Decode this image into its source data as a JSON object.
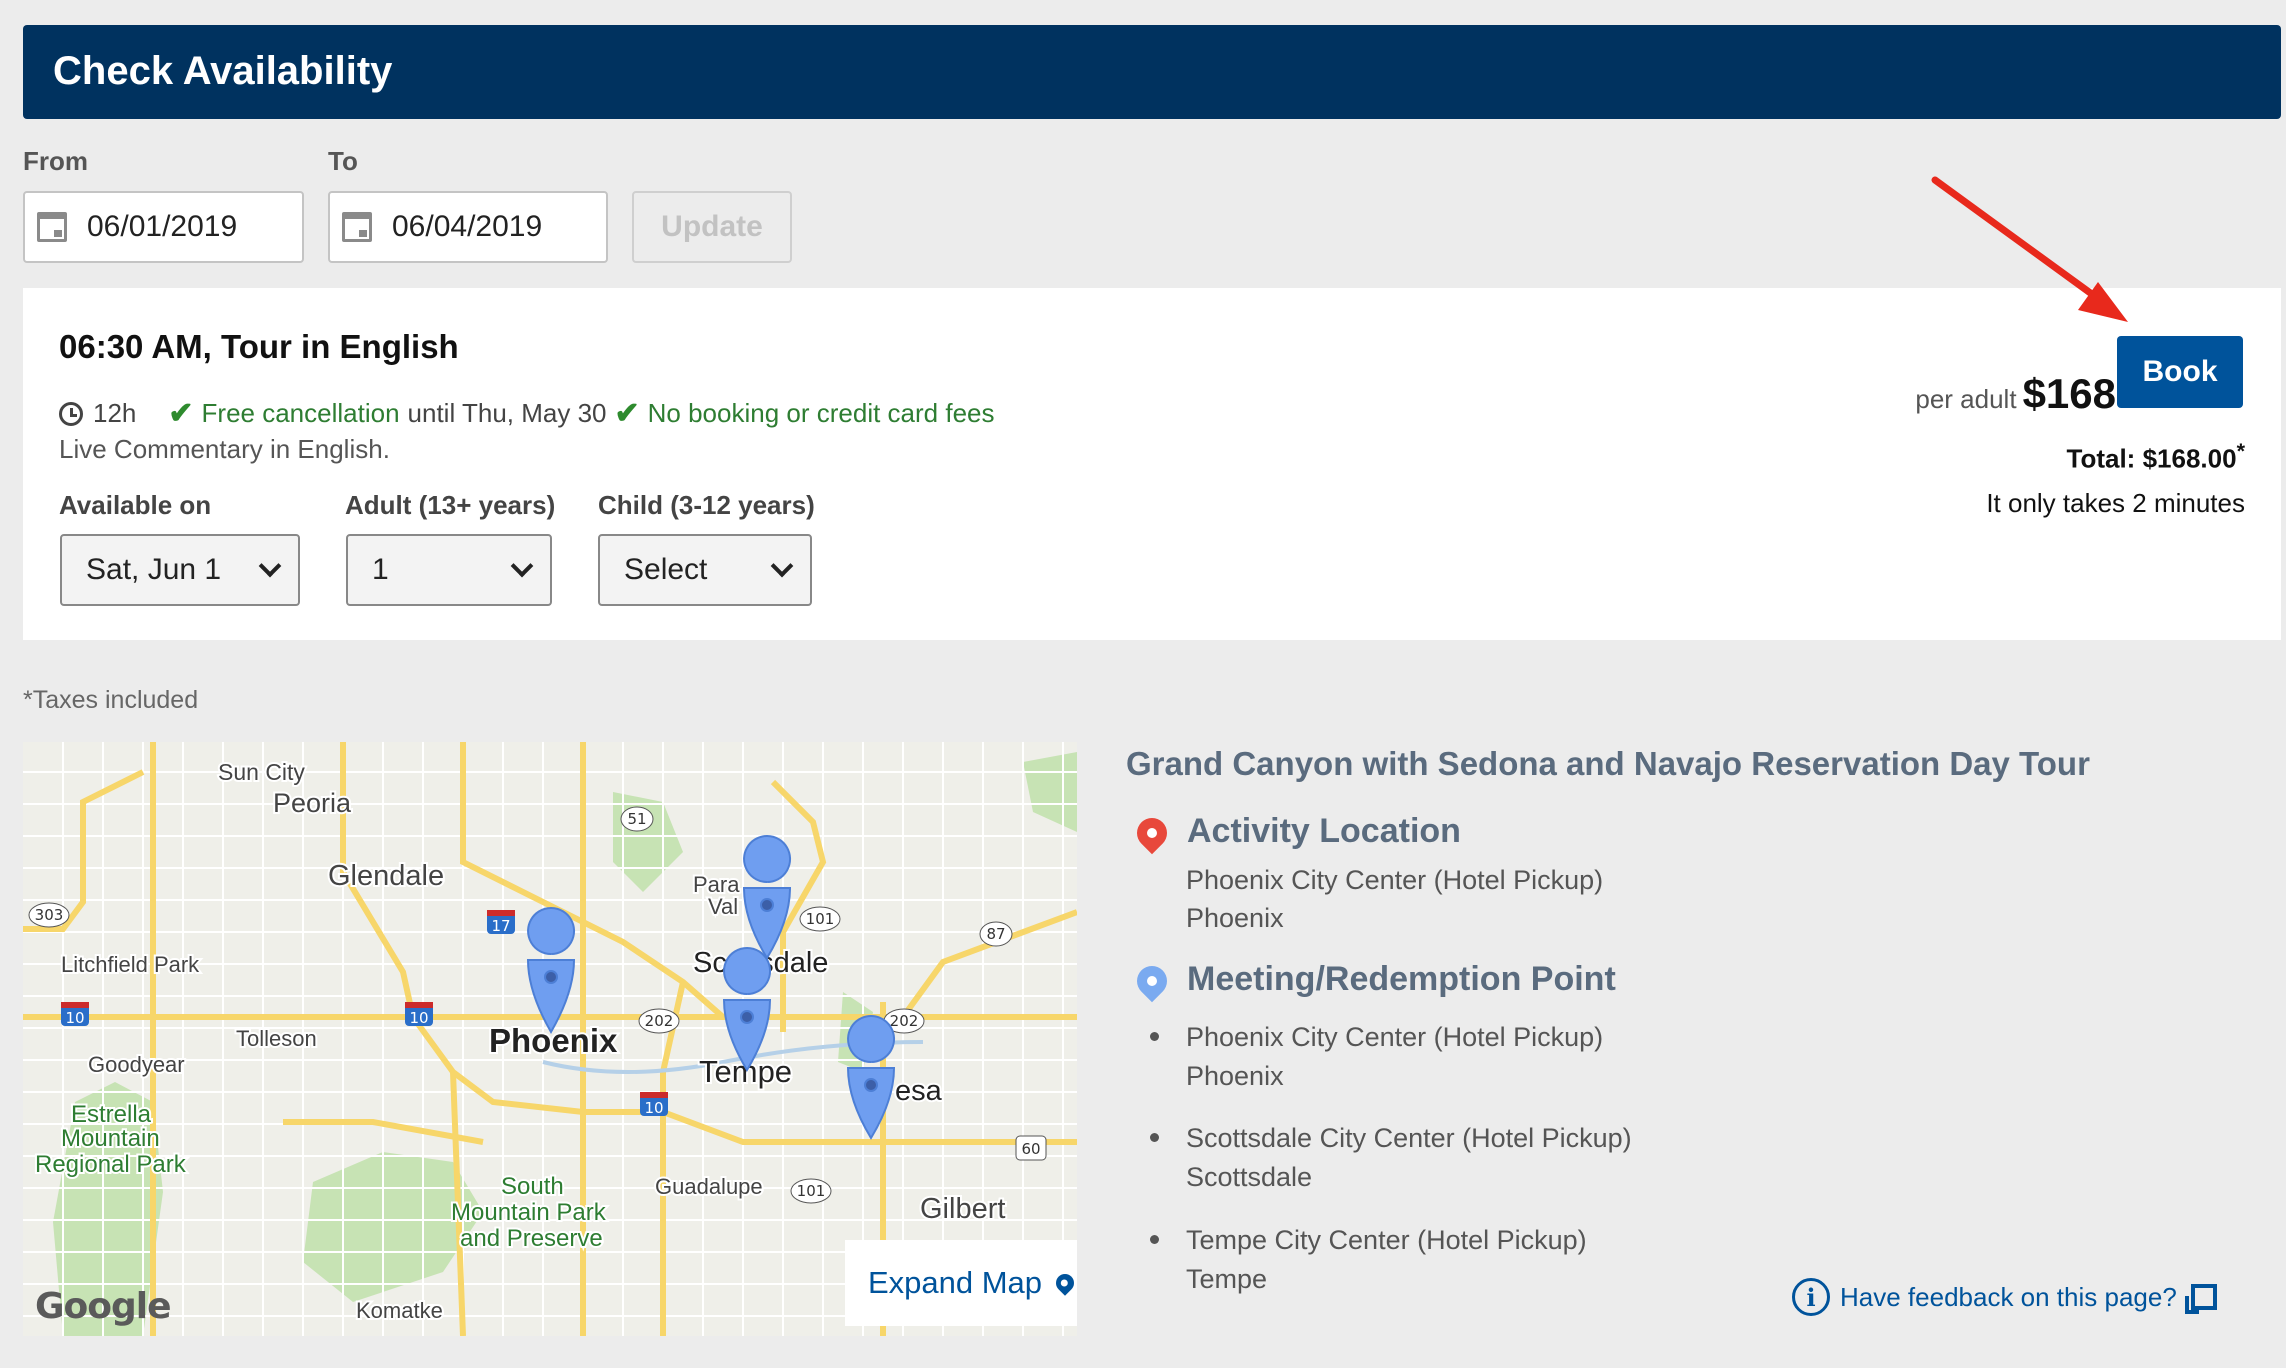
{
  "header": {
    "title": "Check Availability"
  },
  "dates": {
    "from_label": "From",
    "to_label": "To",
    "from_value": "06/01/2019",
    "to_value": "06/04/2019",
    "update_label": "Update"
  },
  "tour": {
    "title": "06:30 AM, Tour in English",
    "duration": "12h",
    "free_cancel": "Free cancellation",
    "cancel_until": "until Thu, May 30",
    "no_fees": "No booking or credit card fees",
    "commentary": "Live Commentary in English.",
    "available_label": "Available on",
    "available_value": "Sat, Jun 1",
    "adult_label": "Adult (13+ years)",
    "adult_value": "1",
    "child_label": "Child (3-12 years)",
    "child_value": "Select",
    "per_adult_label": "per adult",
    "price": "$168",
    "book_label": "Book",
    "total_label": "Total:",
    "total_value": "$168.00",
    "total_asterisk": "*",
    "only_takes": "It only takes 2 minutes"
  },
  "taxes_note": "*Taxes included",
  "map": {
    "expand_label": "Expand Map",
    "google_label": "Google",
    "places": [
      "Sun City",
      "Peoria",
      "Glendale",
      "Litchfield Park",
      "Tolleson",
      "Phoenix",
      "Goodyear",
      "Estrella",
      "Mountain",
      "Regional Park",
      "Para",
      "Val",
      "Scottsdale",
      "Tempe",
      "esa",
      "South",
      "Mountain Park",
      "and Preserve",
      "Guadalupe",
      "Gilbert",
      "Komatke"
    ],
    "road_shields": [
      "303",
      "51",
      "17",
      "101",
      "87",
      "10",
      "10",
      "202",
      "202",
      "10",
      "60",
      "101"
    ]
  },
  "details": {
    "title": "Grand Canyon with Sedona and Navajo Reservation Day Tour",
    "activity_heading": "Activity Location",
    "activity_line1": "Phoenix City Center (Hotel Pickup)",
    "activity_line2": "Phoenix",
    "meeting_heading": "Meeting/Redemption Point",
    "points": [
      {
        "name": "Phoenix City Center (Hotel Pickup)",
        "city": "Phoenix"
      },
      {
        "name": "Scottsdale City Center (Hotel Pickup)",
        "city": "Scottsdale"
      },
      {
        "name": "Tempe City Center (Hotel Pickup)",
        "city": "Tempe"
      }
    ],
    "activity_pin_color": "#e8483b",
    "meeting_pin_color": "#7aaaf0"
  },
  "feedback": {
    "label": "Have feedback on this page?"
  },
  "colors": {
    "brand_dark": "#00325f",
    "brand_blue": "#00539b",
    "annotation_red": "#e8291c"
  }
}
